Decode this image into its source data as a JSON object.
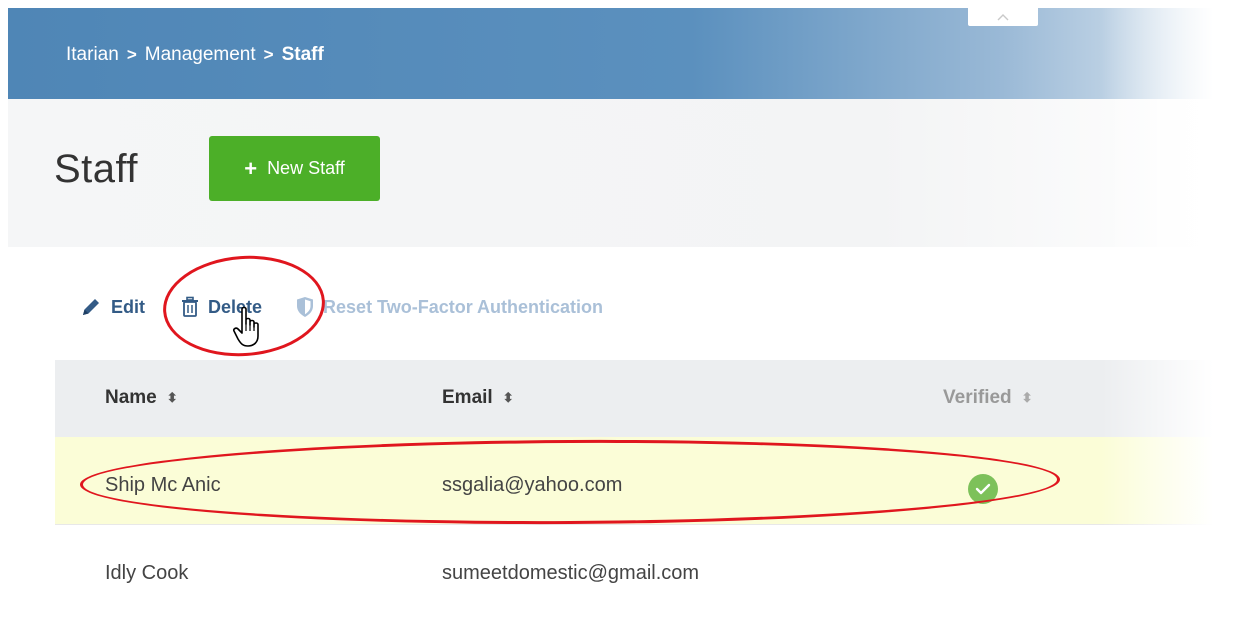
{
  "breadcrumb": {
    "items": [
      "Itarian",
      "Management",
      "Staff"
    ],
    "separator": ">"
  },
  "page": {
    "title": "Staff",
    "new_button_label": "New Staff"
  },
  "toolbar": {
    "edit_label": "Edit",
    "delete_label": "Delete",
    "reset_label": "Reset Two-Factor Authentication"
  },
  "table": {
    "columns": [
      {
        "label": "Name",
        "sortable": true
      },
      {
        "label": "Email",
        "sortable": true
      },
      {
        "label": "Verified",
        "sortable": true
      }
    ],
    "rows": [
      {
        "name": "Ship Mc Anic",
        "email": "ssgalia@yahoo.com",
        "verified": true,
        "selected": true
      },
      {
        "name": "Idly Cook",
        "email": "sumeetdomestic@gmail.com",
        "verified": false,
        "selected": false
      }
    ]
  },
  "colors": {
    "header_blue": "#5b90be",
    "button_green": "#4caf28",
    "selected_row": "#fbfdd7",
    "annotation_red": "#e0161e",
    "verified_green": "#7dc15a"
  },
  "icons": {
    "edit": "pencil-icon",
    "delete": "trash-icon",
    "reset": "shield-icon",
    "verified": "check-circle-icon",
    "cursor": "hand-cursor-icon"
  }
}
